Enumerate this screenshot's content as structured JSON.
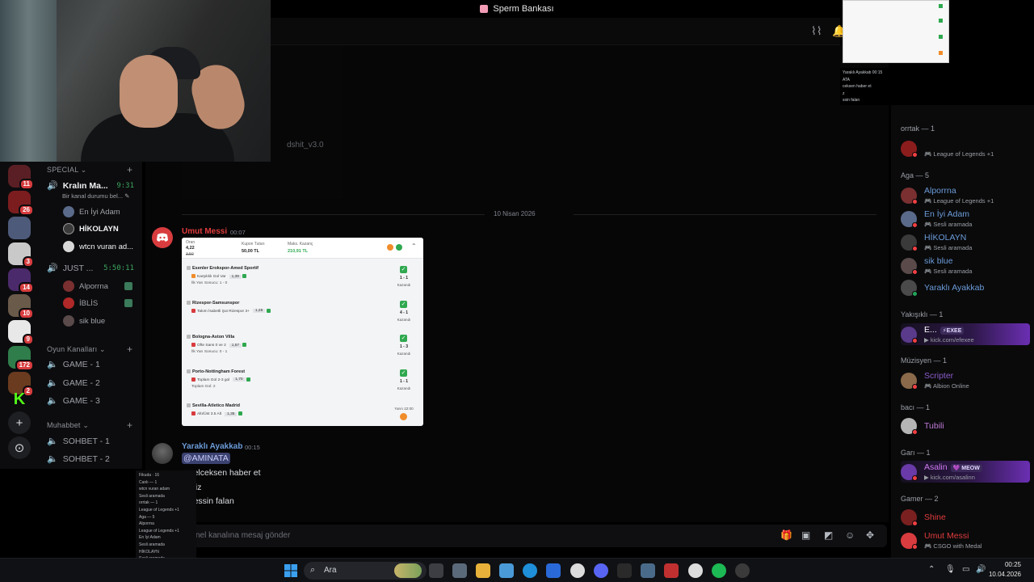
{
  "window": {
    "title": "Sperm Bankası"
  },
  "servers": [
    {
      "badge": "11",
      "color": "#5a1f24"
    },
    {
      "badge": "26",
      "color": "#7b1d1f"
    },
    {
      "badge": "",
      "color": "#4d5a7a"
    },
    {
      "badge": "3",
      "color": "#c9c9c9"
    },
    {
      "badge": "14",
      "color": "#4b2a6b"
    },
    {
      "badge": "10",
      "color": "#6a5a4a"
    },
    {
      "badge": "9",
      "color": "#e8e8e8"
    },
    {
      "badge": "172",
      "color": "#2f7d4a"
    },
    {
      "badge": "2",
      "color": "#6a3b1f"
    }
  ],
  "server_actions": {
    "kick_label": "K",
    "add_label": "+",
    "discover_label": "⊙"
  },
  "sidebar": {
    "special_category": "SPECIAL",
    "kralin_channel": "Kralın Ma...",
    "kralin_timer": "9:31",
    "kralin_status": "Bir kanal durumu bel...",
    "kralin_users": [
      "En İyi Adam",
      "HİKOLAYN",
      "wtcn vuran ad..."
    ],
    "just_channel": "JUST ...",
    "just_timer": "5:50:11",
    "just_users": [
      "Alporrna",
      "İBLİS",
      "sik blue"
    ],
    "game_category": "Oyun Kanalları",
    "game_channels": [
      "GAME - 1",
      "GAME - 2",
      "GAME - 3"
    ],
    "muhabbet_category": "Muhabbet",
    "muhabbet_channels": [
      "SOHBET - 1",
      "SOHBET - 2"
    ]
  },
  "mini_popout": {
    "lines": [
      "Fikuda · 16",
      "Canlı — 1",
      "wtcn vuran adam",
      "Sesli aramada",
      "orrtak — 1",
      "League of Legends +1",
      "Aga — 5",
      "Alporrna",
      "League of Legends +1",
      "En İyi Adam",
      "Sesli aramada",
      "HİKOLAYN",
      "Sesli aramada",
      "sik blue",
      "Sesli aramada"
    ]
  },
  "chat": {
    "embed_caption": "dshit_v3.0",
    "date_divider": "10 Nisan 2026",
    "message1": {
      "author": "Umut Messi",
      "time": "00:07",
      "author_color": "#e03b3b"
    },
    "message2": {
      "author": "Yaraklı Ayakkab",
      "time": "00:15",
      "author_color": "#6b9bd8",
      "mention": "@AMINATA",
      "lines": [
        "a gelceksen haber et",
        "deyiz",
        "emessin falan"
      ]
    },
    "composer_placeholder": "nel kanalına mesaj gönder"
  },
  "bet_slip": {
    "odds_label": "Oran",
    "odds_value": "4,22",
    "odds_old": "3,50",
    "stake_label": "Kupon Tutarı",
    "stake_value": "50,00 TL",
    "max_label": "Maks. Kazanç",
    "max_value": "210,91 TL",
    "matches": [
      {
        "name": "Esenler Erokspor-Amed Sportif",
        "pick": "Karşılıklı Gol Var",
        "odds": "1,39",
        "sub": "İlk Yarı Sonucu: 1 - 0",
        "score": "1 - 1",
        "result": "Kazandı"
      },
      {
        "name": "Rizespor-Samsunspor",
        "pick": "Takım İsabetli Şut Rizespor 3+",
        "odds": "1,28",
        "sub": "",
        "score": "4 - 1",
        "result": "Kazandı"
      },
      {
        "name": "Bologna-Aston Villa",
        "pick": "Ofte Sans 0 ve 2",
        "odds": "1,57",
        "sub": "İlk Yarı Sonucu: 0 - 1",
        "score": "1 - 3",
        "result": "Kazandı"
      },
      {
        "name": "Porto-Nottingham Forest",
        "pick": "Toplam Gol 2-3 gol",
        "odds": "1,70",
        "sub": "Toplam Gol: 2",
        "score": "1 - 1",
        "result": "Kazandı"
      },
      {
        "name": "Sevilla-Atletico Madrid",
        "pick": "Altı/Üst 3.5 Alt",
        "odds": "1,35",
        "sub": "",
        "score": "",
        "result": "Yarın 22:00"
      }
    ]
  },
  "members": {
    "groups": [
      {
        "label": "orrtak — 1"
      },
      {
        "label": "Aga — 5"
      },
      {
        "label": "Yakışıklı — 1"
      },
      {
        "label": "Müzisyen — 1"
      },
      {
        "label": "bacı — 1"
      },
      {
        "label": "Garı — 1"
      },
      {
        "label": "Gamer — 2"
      }
    ],
    "list": [
      {
        "name": "",
        "activity": "League of Legends +1",
        "color": "#e03b3b",
        "av": "#8c1d1d"
      },
      {
        "name": "Alporrna",
        "activity": "League of Legends +1",
        "color": "#6b9bd8",
        "av": "#7a3030"
      },
      {
        "name": "En İyi Adam",
        "activity": "Sesli aramada",
        "color": "#6b9bd8",
        "av": "#5a6a8a"
      },
      {
        "name": "HİKOLAYN",
        "activity": "Sesli aramada",
        "color": "#6b9bd8",
        "av": "#3a3a3a"
      },
      {
        "name": "sik blue",
        "activity": "Sesli aramada",
        "color": "#6b9bd8",
        "av": "#5a4a4a"
      },
      {
        "name": "Yaraklı Ayakkab",
        "activity": "",
        "color": "#6b9bd8",
        "av": "#4a4a4a"
      },
      {
        "name": "E...",
        "activity": "kick.com/efexee",
        "color": "#ffffff",
        "av": "#5a3a8a",
        "tag": "⚡EXEE"
      },
      {
        "name": "Scripter",
        "activity": "Albion Online",
        "color": "#8a5bc7",
        "av": "#8a6a4a"
      },
      {
        "name": "Tubili",
        "activity": "",
        "color": "#c07ad8",
        "av": "#b5b5b5"
      },
      {
        "name": "Asalin",
        "activity": "kick.com/asalinn",
        "color": "#d07af0",
        "av": "#6a3aa8",
        "tag": "💜 MEOW"
      },
      {
        "name": "Shine",
        "activity": "",
        "color": "#e03b3b",
        "av": "#7a2020"
      },
      {
        "name": "Umut Messi",
        "activity": "CSGO with Medal",
        "color": "#e03b3b",
        "av": "#d83c3e"
      }
    ]
  },
  "preview_text": [
    "Yaraklı Ayakkab  00:15",
    "ATA",
    "ceksen haber et",
    "z",
    "ssin falan"
  ],
  "taskbar": {
    "search_label": "Ara",
    "time": "00:25",
    "date": "10.04.2026"
  }
}
